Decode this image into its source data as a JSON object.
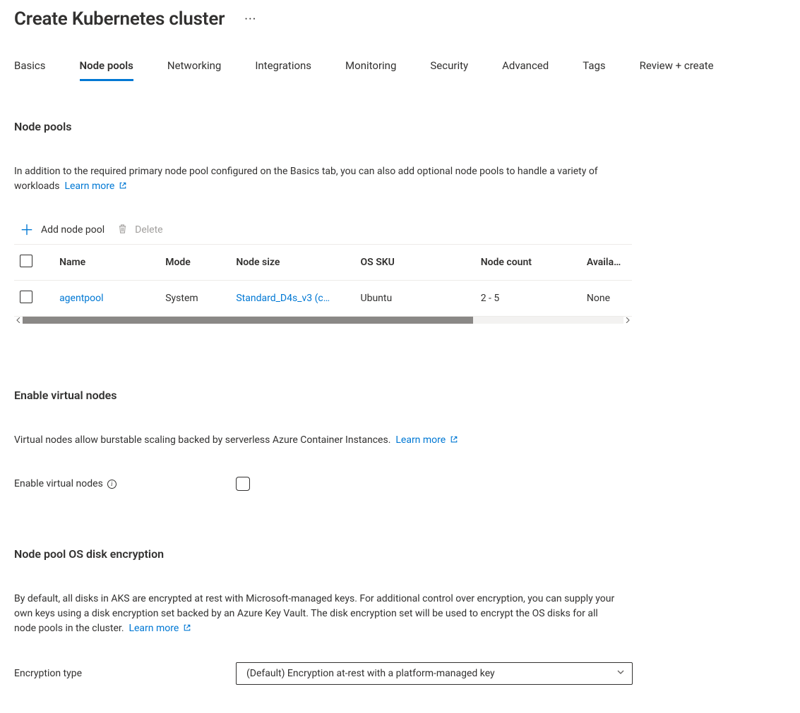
{
  "header": {
    "title": "Create Kubernetes cluster"
  },
  "tabs": [
    {
      "label": "Basics",
      "active": false
    },
    {
      "label": "Node pools",
      "active": true
    },
    {
      "label": "Networking",
      "active": false
    },
    {
      "label": "Integrations",
      "active": false
    },
    {
      "label": "Monitoring",
      "active": false
    },
    {
      "label": "Security",
      "active": false
    },
    {
      "label": "Advanced",
      "active": false
    },
    {
      "label": "Tags",
      "active": false
    },
    {
      "label": "Review + create",
      "active": false
    }
  ],
  "node_pools": {
    "heading": "Node pools",
    "description": "In addition to the required primary node pool configured on the Basics tab, you can also add optional node pools to handle a variety of workloads",
    "learn_more": "Learn more",
    "toolbar": {
      "add_label": "Add node pool",
      "delete_label": "Delete"
    },
    "columns": {
      "name": "Name",
      "mode": "Mode",
      "size": "Node size",
      "sku": "OS SKU",
      "count": "Node count",
      "availability": "Availability zones"
    },
    "rows": [
      {
        "name": "agentpool",
        "mode": "System",
        "size": "Standard_D4s_v3 (c…",
        "sku": "Ubuntu",
        "count": "2 - 5",
        "availability": "None"
      }
    ]
  },
  "virtual_nodes": {
    "heading": "Enable virtual nodes",
    "description": "Virtual nodes allow burstable scaling backed by serverless Azure Container Instances.",
    "learn_more": "Learn more",
    "checkbox_label": "Enable virtual nodes"
  },
  "encryption": {
    "heading": "Node pool OS disk encryption",
    "description": "By default, all disks in AKS are encrypted at rest with Microsoft-managed keys. For additional control over encryption, you can supply your own keys using a disk encryption set backed by an Azure Key Vault. The disk encryption set will be used to encrypt the OS disks for all node pools in the cluster.",
    "learn_more": "Learn more",
    "type_label": "Encryption type",
    "type_value": "(Default) Encryption at-rest with a platform-managed key"
  }
}
